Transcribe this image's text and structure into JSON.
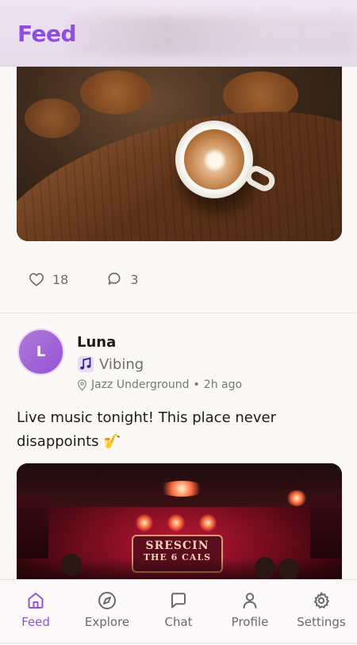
{
  "header": {
    "title": "Feed"
  },
  "post1": {
    "likes": "18",
    "comments": "3"
  },
  "post2": {
    "avatar_initial": "L",
    "username": "Luna",
    "mood_icon": "music-note-icon",
    "mood": "Vibing",
    "location": "Jazz Underground",
    "time": "2h ago",
    "text": "Live music tonight! This place never disappoints",
    "text_emoji": "🎷",
    "sign_text_line1": "SRESCIN",
    "sign_text_line2": "THE 6 CALS"
  },
  "nav": {
    "items": [
      {
        "label": "Feed",
        "icon": "home-icon",
        "active": true
      },
      {
        "label": "Explore",
        "icon": "compass-icon",
        "active": false
      },
      {
        "label": "Chat",
        "icon": "chat-icon",
        "active": false
      },
      {
        "label": "Profile",
        "icon": "user-icon",
        "active": false
      },
      {
        "label": "Settings",
        "icon": "gear-icon",
        "active": false
      }
    ]
  },
  "colors": {
    "accent": "#9255d4",
    "header_title": "#8e4fe0",
    "avatar_start": "#b07ad8",
    "avatar_end": "#9553d6"
  }
}
